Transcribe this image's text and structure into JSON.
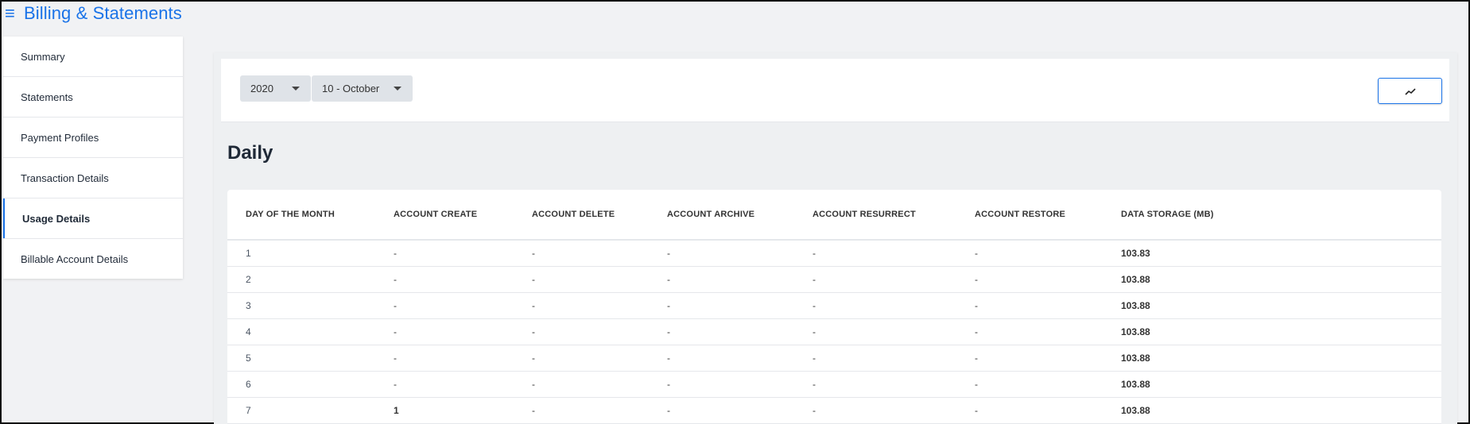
{
  "app": {
    "title": "Billing & Statements",
    "menu_icon": "hamburger-menu-icon"
  },
  "sidebar": {
    "items": [
      {
        "label": "Summary"
      },
      {
        "label": "Statements"
      },
      {
        "label": "Payment Profiles"
      },
      {
        "label": "Transaction Details"
      },
      {
        "label": "Usage Details",
        "active": true
      },
      {
        "label": "Billable Account Details"
      }
    ]
  },
  "filters": {
    "year": "2020",
    "month": "10 - October",
    "chart_button_icon": "line-chart-icon"
  },
  "section": {
    "title": "Daily"
  },
  "table": {
    "headers": [
      "DAY OF THE MONTH",
      "ACCOUNT CREATE",
      "ACCOUNT DELETE",
      "ACCOUNT ARCHIVE",
      "ACCOUNT RESURRECT",
      "ACCOUNT RESTORE",
      "DATA STORAGE (MB)"
    ],
    "rows": [
      [
        "1",
        "-",
        "-",
        "-",
        "-",
        "-",
        "103.83"
      ],
      [
        "2",
        "-",
        "-",
        "-",
        "-",
        "-",
        "103.88"
      ],
      [
        "3",
        "-",
        "-",
        "-",
        "-",
        "-",
        "103.88"
      ],
      [
        "4",
        "-",
        "-",
        "-",
        "-",
        "-",
        "103.88"
      ],
      [
        "5",
        "-",
        "-",
        "-",
        "-",
        "-",
        "103.88"
      ],
      [
        "6",
        "-",
        "-",
        "-",
        "-",
        "-",
        "103.88"
      ],
      [
        "7",
        "1",
        "-",
        "-",
        "-",
        "-",
        "103.88"
      ]
    ]
  },
  "colors": {
    "accent": "#1a73e8",
    "background": "#f1f2f4",
    "select_bg": "#dfe3e8"
  }
}
